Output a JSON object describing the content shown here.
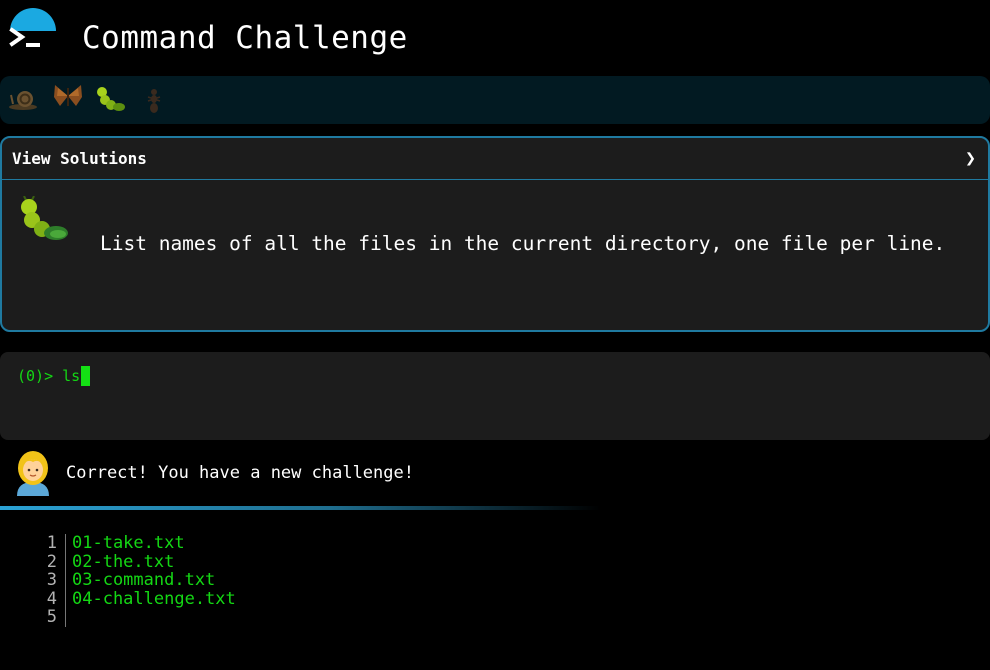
{
  "app": {
    "title": "Command Challenge",
    "logo_icon": "terminal-prompt-icon"
  },
  "levels": [
    {
      "name": "snail-icon",
      "state": "dim"
    },
    {
      "name": "butterfly-icon",
      "state": "dim"
    },
    {
      "name": "caterpillar-icon",
      "state": "active"
    },
    {
      "name": "ant-icon",
      "state": "dim"
    }
  ],
  "challenge": {
    "view_solutions_label": "View Solutions",
    "expand_icon": "chevron-right-icon",
    "level_icon": "caterpillar-icon",
    "description": "List names of all the files in the current directory, one file per line."
  },
  "terminal": {
    "prompt": "(0)> ",
    "input_value": "ls"
  },
  "feedback": {
    "avatar_icon": "woman-avatar-icon",
    "message": "Correct! You have a new challenge!"
  },
  "output": {
    "lines": [
      {
        "num": "1",
        "text": "01-take.txt"
      },
      {
        "num": "2",
        "text": "02-the.txt"
      },
      {
        "num": "3",
        "text": "03-command.txt"
      },
      {
        "num": "4",
        "text": "04-challenge.txt"
      },
      {
        "num": "5",
        "text": ""
      }
    ]
  },
  "colors": {
    "accent": "#1ba9e1",
    "terminal_green": "#14d714",
    "card_bg": "#1c1c1c",
    "card_border": "#1f7aa0",
    "levels_bg": "#021a22"
  }
}
